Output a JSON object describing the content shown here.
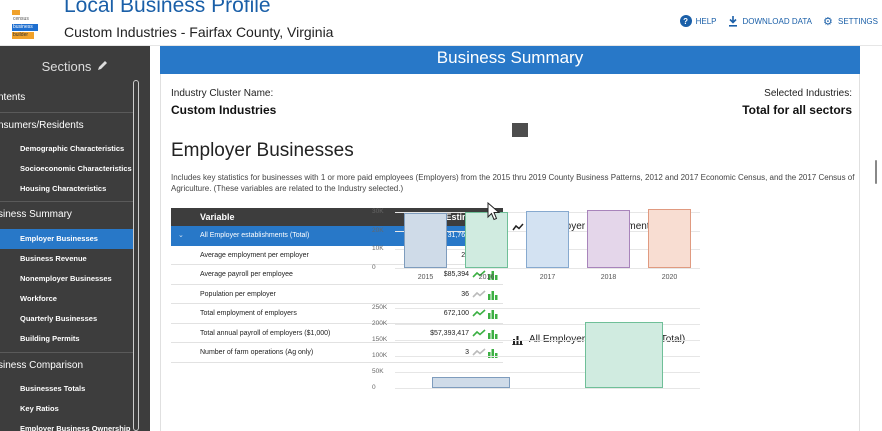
{
  "header": {
    "logo": {
      "line0": "census",
      "line1": "business",
      "line2": "builder"
    },
    "title": "Local Business Profile",
    "subtitle": "Custom Industries - Fairfax County, Virginia",
    "links": [
      {
        "label": "HELP",
        "icon": "help-icon"
      },
      {
        "label": "DOWNLOAD DATA",
        "icon": "download-icon"
      },
      {
        "label": "SETTINGS",
        "icon": "gear-icon"
      }
    ]
  },
  "sidebar": {
    "heading": "Sections",
    "items": [
      {
        "label": "ntents",
        "kind": "group"
      },
      {
        "label": "nsumers/Residents",
        "kind": "group"
      },
      {
        "label": "Demographic Characteristics",
        "kind": "sub"
      },
      {
        "label": "Socioeconomic Characteristics",
        "kind": "sub"
      },
      {
        "label": "Housing Characteristics",
        "kind": "sub"
      },
      {
        "label": "siness Summary",
        "kind": "group"
      },
      {
        "label": "Employer Businesses",
        "kind": "sub",
        "active": true
      },
      {
        "label": "Business Revenue",
        "kind": "sub"
      },
      {
        "label": "Nonemployer Businesses",
        "kind": "sub"
      },
      {
        "label": "Workforce",
        "kind": "sub"
      },
      {
        "label": "Quarterly Businesses",
        "kind": "sub"
      },
      {
        "label": "Building Permits",
        "kind": "sub"
      },
      {
        "label": "siness Comparison",
        "kind": "group"
      },
      {
        "label": "Businesses Totals",
        "kind": "sub"
      },
      {
        "label": "Key Ratios",
        "kind": "sub"
      },
      {
        "label": "Employer Business Ownership",
        "kind": "sub"
      }
    ]
  },
  "main": {
    "banner": "Business Summary",
    "cluster_label": "Industry Cluster Name:",
    "cluster_value": "Custom Industries",
    "selected_label": "Selected Industries:",
    "selected_value": "Total for all sectors",
    "section_title": "Employer Businesses",
    "description": "Includes key statistics for businesses with 1 or more paid employees (Employers) from the 2015 thru 2019 County Business Patterns, 2012 and 2017 Economic Census, and the 2017 Census of Agriculture. (These variables are related to the Industry selected.)",
    "table": {
      "headers": [
        "Variable",
        "Estimate"
      ],
      "rows": [
        {
          "name": "All Employer establishments (Total)",
          "value": "31,769",
          "selected": true,
          "trend": true
        },
        {
          "name": "Average employment per employer",
          "value": "21",
          "trend": true
        },
        {
          "name": "Average payroll per employee",
          "value": "$85,394",
          "trend": true
        },
        {
          "name": "Population per employer",
          "value": "36",
          "trend": false
        },
        {
          "name": "Total employment of employers",
          "value": "672,100",
          "trend": true
        },
        {
          "name": "Total annual payroll of employers ($1,000)",
          "value": "$57,393,417",
          "trend": true
        },
        {
          "name": "Number of farm operations (Ag only)",
          "value": "3",
          "trend": false
        }
      ]
    }
  },
  "colors": {
    "accent": "#2878c8",
    "sidebar_bg": "#3d3d3d",
    "trend_green": "#3cb043"
  },
  "chart_data": [
    {
      "type": "bar",
      "title": "All Employer establishments (Total)",
      "categories": [
        "2015",
        "2016",
        "2017",
        "2018",
        "2020"
      ],
      "values": [
        29500,
        30100,
        30500,
        31000,
        31769
      ],
      "bar_colors": [
        {
          "fill": "#cfdbe8",
          "stroke": "#7e9cbd"
        },
        {
          "fill": "#d0ebe0",
          "stroke": "#6fbf98"
        },
        {
          "fill": "#d3e2f2",
          "stroke": "#86a9cf"
        },
        {
          "fill": "#e4d6ea",
          "stroke": "#a884bb"
        },
        {
          "fill": "#f8ddd2",
          "stroke": "#e09a80"
        }
      ],
      "ylim": [
        0,
        35000
      ],
      "yticks": [
        "30K",
        "20K",
        "10K",
        "0"
      ],
      "grid": true
    },
    {
      "type": "bar",
      "title": "All Employer establishments (Total)",
      "categories": [
        "",
        ""
      ],
      "values": [
        35000,
        205000
      ],
      "bar_colors": [
        {
          "fill": "#cfdbe8",
          "stroke": "#7e9cbd"
        },
        {
          "fill": "#d0ebe0",
          "stroke": "#6fbf98"
        }
      ],
      "ylim": [
        0,
        250000
      ],
      "yticks": [
        "250K",
        "200K",
        "150K",
        "100K",
        "50K",
        "0"
      ],
      "grid": true
    }
  ]
}
